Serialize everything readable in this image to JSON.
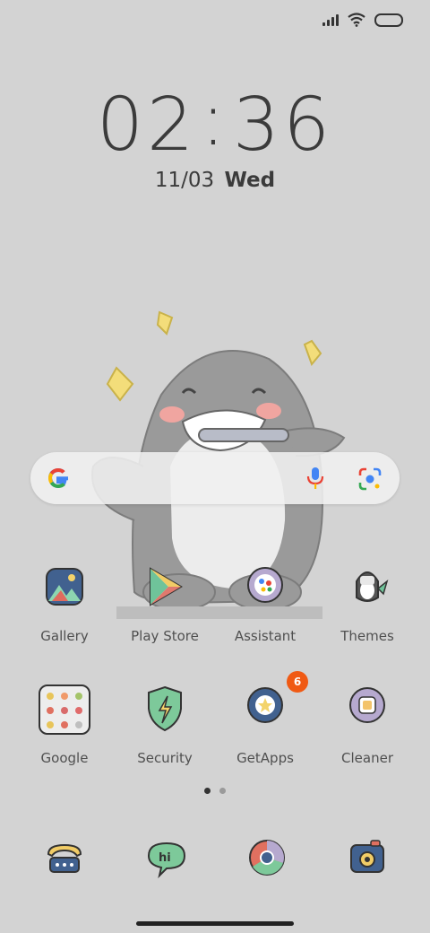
{
  "clock": {
    "hours": "02",
    "minutes": "36"
  },
  "date": {
    "date": "11/03",
    "day": "Wed"
  },
  "search": {
    "brand_letter": "G"
  },
  "apps": [
    {
      "label": "Gallery",
      "badge": ""
    },
    {
      "label": "Play Store",
      "badge": ""
    },
    {
      "label": "Assistant",
      "badge": ""
    },
    {
      "label": "Themes",
      "badge": ""
    },
    {
      "label": "Google",
      "badge": ""
    },
    {
      "label": "Security",
      "badge": ""
    },
    {
      "label": "GetApps",
      "badge": "6"
    },
    {
      "label": "Cleaner",
      "badge": ""
    }
  ],
  "page_indicator": {
    "pages": 2,
    "current": 1
  },
  "dock": [
    {
      "icon": "phone-icon"
    },
    {
      "icon": "messaging-icon"
    },
    {
      "icon": "browser-icon"
    },
    {
      "icon": "camera-icon"
    }
  ],
  "colors": {
    "background": "#d3d3d3",
    "badge": "#f05a14",
    "text": "#3b3b3b"
  }
}
